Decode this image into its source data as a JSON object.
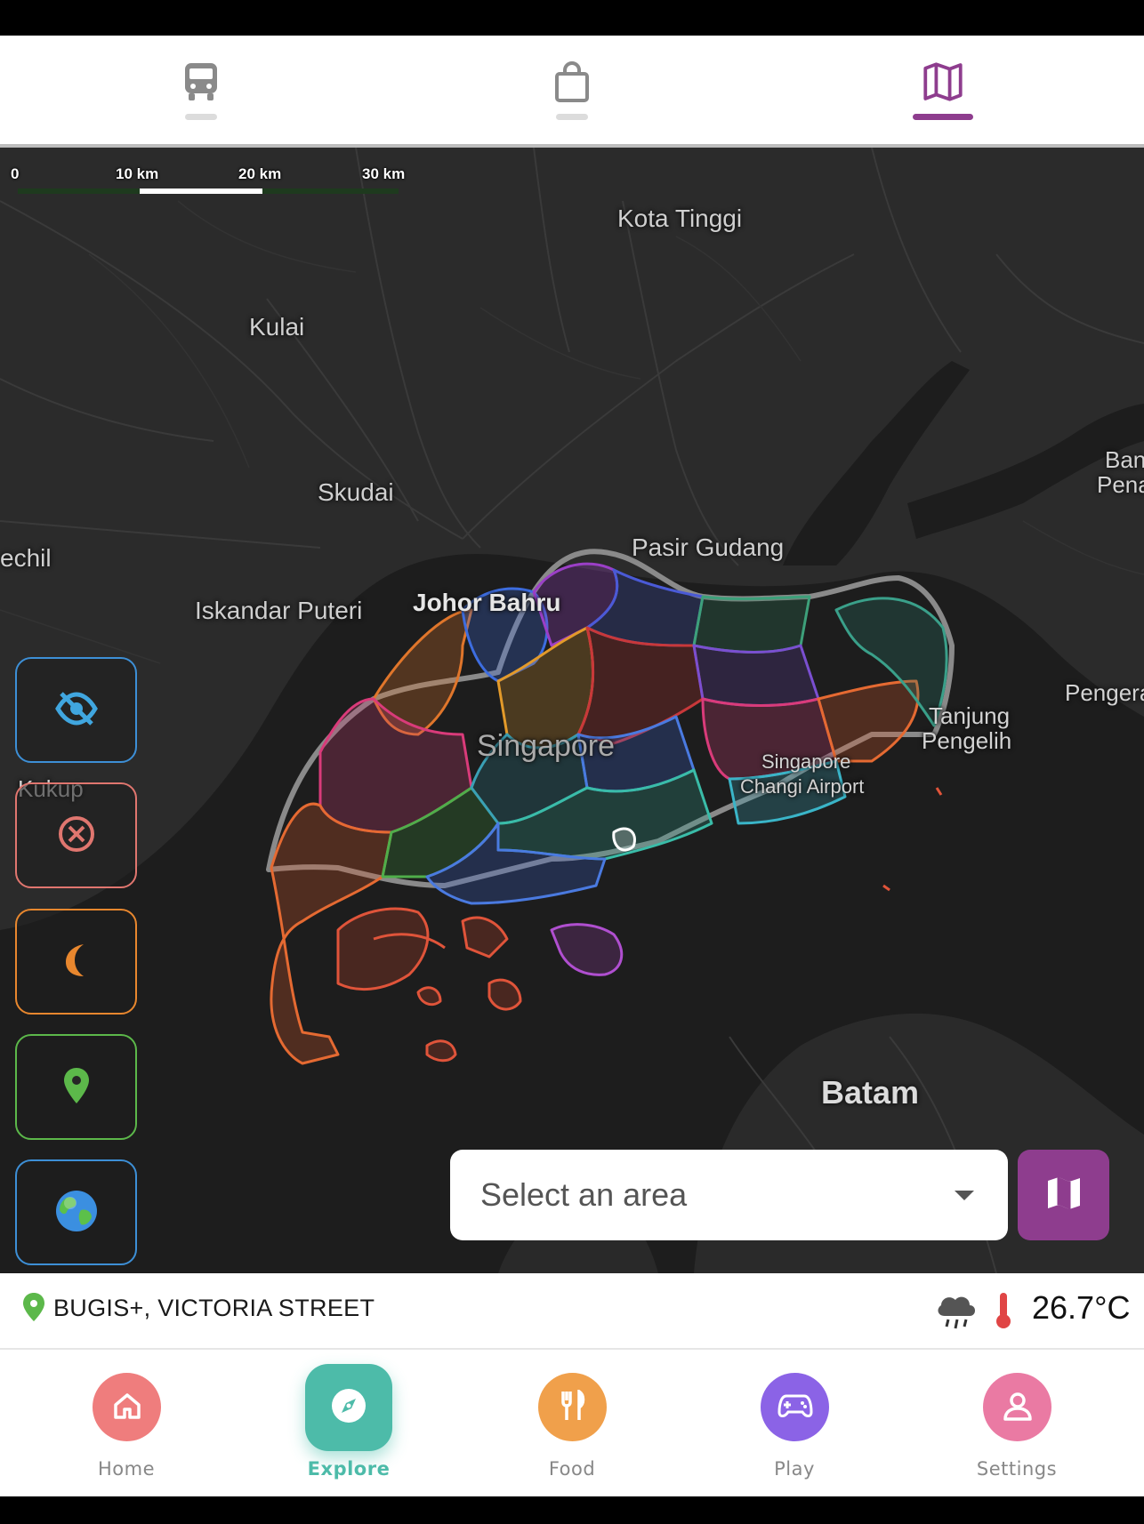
{
  "top_tabs": [
    {
      "name": "bus",
      "icon": "bus-icon",
      "active": false
    },
    {
      "name": "shopping",
      "icon": "shopping-bag-icon",
      "active": false
    },
    {
      "name": "map",
      "icon": "map-icon",
      "active": true
    }
  ],
  "colors": {
    "accent": "#8e3d8e",
    "explore": "#4dbba9",
    "home": "#ef7d7d",
    "food": "#f0a04b",
    "play": "#8b63e6",
    "settings": "#ea7aa3"
  },
  "map": {
    "scale": {
      "labels": [
        "0",
        "10 km",
        "20 km",
        "30 km"
      ]
    },
    "places": {
      "kota_tinggi": "Kota Tinggi",
      "kulai": "Kulai",
      "skudai": "Skudai",
      "pasir_gudang": "Pasir Gudang",
      "pontian_kechil": "echil",
      "iskandar_puteri": "Iskandar Puteri",
      "johor_bahru": "Johor Bahru",
      "bandar_penawar_1": "Ban",
      "bandar_penawar_2": "Pena",
      "pengerang": "Pengera",
      "tanjung_pengelih_1": "Tanjung",
      "tanjung_pengelih_2": "Pengelih",
      "kukup": "Kukup",
      "singapore": "Singapore",
      "changi_1": "Singapore",
      "changi_2": "Changi Airport",
      "batam": "Batam"
    }
  },
  "controls": [
    {
      "name": "hide-layer-button",
      "icon": "eye-off-icon",
      "border": "#3d8fd6"
    },
    {
      "name": "clear-button",
      "icon": "close-circle-icon",
      "border": "#e0766f"
    },
    {
      "name": "dark-mode-button",
      "icon": "moon-icon",
      "border": "#e8872e"
    },
    {
      "name": "my-location-button",
      "icon": "location-pin-icon",
      "border": "#5cb84a"
    },
    {
      "name": "globe-button",
      "icon": "globe-icon",
      "border": "#3d8fd6"
    }
  ],
  "area_select": {
    "placeholder": "Select an area"
  },
  "info": {
    "location": "BUGIS+, VICTORIA STREET",
    "weather_icon": "rain-cloud-icon",
    "temperature": "26.7°C"
  },
  "bottom_nav": [
    {
      "label": "Home",
      "icon": "home-icon",
      "active": false
    },
    {
      "label": "Explore",
      "icon": "compass-icon",
      "active": true
    },
    {
      "label": "Food",
      "icon": "utensils-icon",
      "active": false
    },
    {
      "label": "Play",
      "icon": "gamepad-icon",
      "active": false
    },
    {
      "label": "Settings",
      "icon": "user-icon",
      "active": false
    }
  ]
}
